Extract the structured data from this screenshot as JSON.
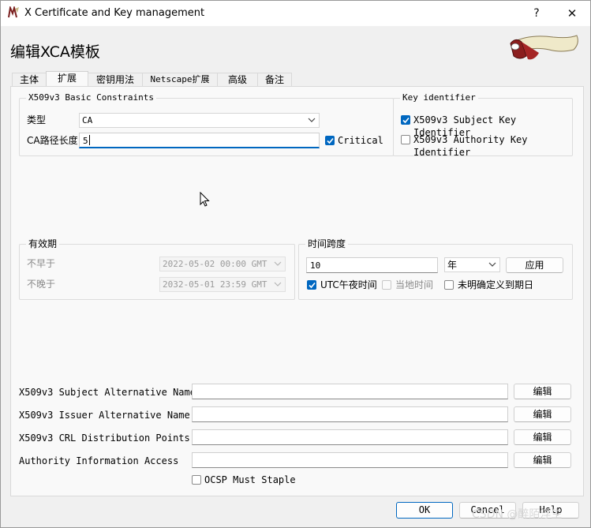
{
  "window": {
    "title": "X Certificate and Key management",
    "help_label": "?",
    "close_label": "✕",
    "heading": "编辑XCA模板"
  },
  "tabs": [
    {
      "label": "主体",
      "active": false
    },
    {
      "label": "扩展",
      "active": true
    },
    {
      "label": "密钥用法",
      "active": false
    },
    {
      "label": "Netscape扩展",
      "active": false
    },
    {
      "label": "高级",
      "active": false
    },
    {
      "label": "备注",
      "active": false
    }
  ],
  "basic_constraints": {
    "title": "X509v3 Basic Constraints",
    "type_label": "类型",
    "type_value": "CA",
    "path_label": "CA路径长度",
    "path_value": "5",
    "critical_label": "Critical",
    "critical_checked": true
  },
  "key_identifier": {
    "title": "Key identifier",
    "subject_label": "X509v3 Subject Key Identifier",
    "subject_checked": true,
    "authority_label": "X509v3 Authority Key Identifier",
    "authority_checked": false
  },
  "validity": {
    "title": "有效期",
    "not_before_label": "不早于",
    "not_before_value": "2022-05-02 00:00 GMT",
    "not_after_label": "不晚于",
    "not_after_value": "2032-05-01 23:59 GMT"
  },
  "time_range": {
    "title": "时间跨度",
    "amount_value": "10",
    "unit_value": "年",
    "apply_label": "应用",
    "utc_label": "UTC午夜时间",
    "utc_checked": true,
    "local_label": "当地时间",
    "local_checked": false,
    "undefined_label": "未明确定义到期日",
    "undefined_checked": false
  },
  "extensions": [
    {
      "label": "X509v3 Subject Alternative Name",
      "value": "",
      "button": "编辑"
    },
    {
      "label": "X509v3 Issuer Alternative Name",
      "value": "",
      "button": "编辑"
    },
    {
      "label": "X509v3 CRL Distribution Points",
      "value": "",
      "button": "编辑"
    },
    {
      "label": "Authority Information Access",
      "value": "",
      "button": "编辑"
    }
  ],
  "ocsp": {
    "label": "OCSP Must Staple",
    "checked": false
  },
  "footer": {
    "ok_label": "OK",
    "cancel_label": "Cancel",
    "help_label": "Help"
  },
  "watermark": "CSDN @醉陌浮生",
  "colors": {
    "accent": "#0067c0",
    "panel": "#f9f9f9",
    "window": "#f0f0f0"
  }
}
